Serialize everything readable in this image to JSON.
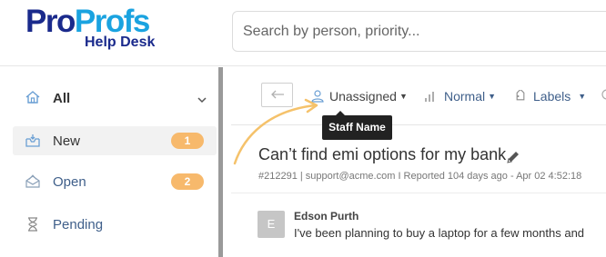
{
  "logo": {
    "main_part1": "Pro",
    "main_part2": "Profs",
    "sub": "Help Desk"
  },
  "search": {
    "placeholder": "Search by person, priority..."
  },
  "sidebar": {
    "all": {
      "label": "All"
    },
    "items": [
      {
        "label": "New",
        "count": "1",
        "icon": "inbox-icon",
        "active": true
      },
      {
        "label": "Open",
        "count": "2",
        "icon": "open-envelope-icon",
        "active": false
      },
      {
        "label": "Pending",
        "count": "",
        "icon": "hourglass-icon",
        "active": false
      }
    ]
  },
  "toolbar": {
    "assignee": "Unassigned",
    "priority": "Normal",
    "labels": "Labels"
  },
  "tooltip": {
    "text": "Staff Name"
  },
  "ticket": {
    "subject": "Can’t find emi options for my bank",
    "meta": "#212291 |  support@acme.com I Reported 104 days ago - Apr 02 4:52:18",
    "sender_initial": "E",
    "sender_name": "Edson Purth",
    "preview": "I've been planning to buy a laptop for a few months and"
  },
  "colors": {
    "brand_dark": "#1a2a8c",
    "brand_light": "#1aa3e0",
    "badge": "#f7b96c",
    "link": "#3f5f8a",
    "arrow": "#f5c26b"
  }
}
